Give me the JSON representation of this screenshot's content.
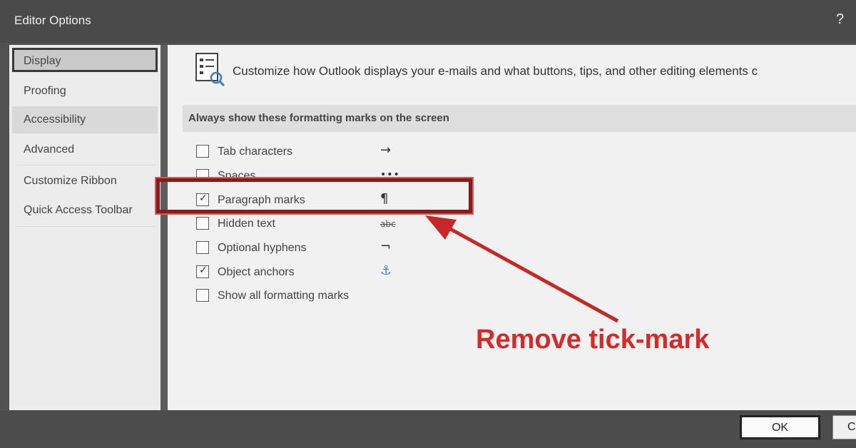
{
  "window": {
    "title": "Editor Options",
    "help_label": "?"
  },
  "sidebar": {
    "items": [
      {
        "label": "Display"
      },
      {
        "label": "Proofing"
      },
      {
        "label": "Accessibility"
      },
      {
        "label": "Advanced"
      },
      {
        "label": "Customize Ribbon"
      },
      {
        "label": "Quick Access Toolbar"
      }
    ]
  },
  "content": {
    "header_text": "Customize how Outlook displays your e-mails and what buttons, tips, and other editing elements c",
    "section_heading": "Always show these formatting marks on the screen",
    "options": [
      {
        "label": "Tab characters",
        "symbol": "→",
        "checked": false
      },
      {
        "label": "Spaces",
        "symbol": "•••",
        "checked": false
      },
      {
        "label": "Paragraph marks",
        "symbol": "¶",
        "checked": true
      },
      {
        "label": "Hidden text",
        "symbol": "abc",
        "checked": false
      },
      {
        "label": "Optional hyphens",
        "symbol": "¬",
        "checked": false
      },
      {
        "label": "Object anchors",
        "symbol": "⚓",
        "checked": true
      },
      {
        "label": "Show all formatting marks",
        "symbol": "",
        "checked": false
      }
    ]
  },
  "annotation": {
    "text": "Remove tick-mark",
    "color": "#d42a2a"
  },
  "footer": {
    "ok_label": "OK",
    "cancel_label": "C"
  },
  "colors": {
    "highlight_border": "#8c1a1a",
    "accent_icon": "#4a7fc0"
  }
}
